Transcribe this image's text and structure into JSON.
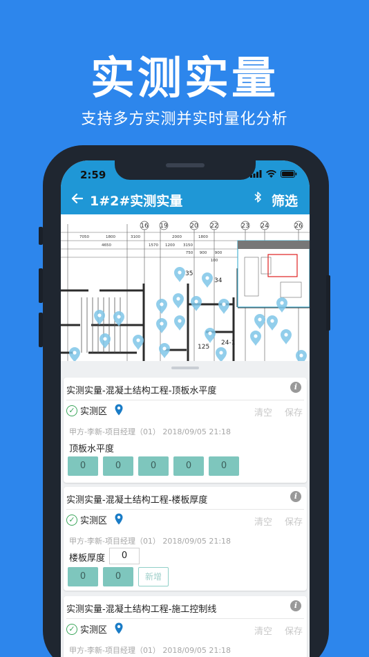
{
  "hero": {
    "title": "实测实量",
    "subtitle": "支持多方实测并实时量化分析"
  },
  "status_bar": {
    "time": "2:59"
  },
  "app_bar": {
    "back_icon": "arrow-left-icon",
    "title": "1#2#实测实量",
    "bluetooth_icon": "bluetooth-icon",
    "filter_label": "筛选"
  },
  "plan": {
    "axis_labels": [
      "16",
      "19",
      "20",
      "22",
      "23",
      "24",
      "26"
    ],
    "dimension_labels": [
      "7050",
      "1800",
      "3100",
      "4650",
      "1570",
      "2000",
      "1200",
      "3150",
      "1800",
      "750",
      "900",
      "900",
      "100"
    ],
    "markers": [
      "35",
      "34",
      "24-1",
      "125"
    ]
  },
  "cards": [
    {
      "title": "实测实量-混凝土结构工程-顶板水平度",
      "zone": "实测区",
      "clear_label": "清空",
      "save_label": "保存",
      "meta": "甲方-李新-项目经理（01） 2018/09/05 21:18",
      "field": "顶板水平度",
      "values": [
        "0",
        "0",
        "0",
        "0",
        "0"
      ]
    },
    {
      "title": "实测实量-混凝土结构工程-楼板厚度",
      "zone": "实测区",
      "clear_label": "清空",
      "save_label": "保存",
      "meta": "甲方-李新-项目经理（01） 2018/09/05 21:18",
      "field": "楼板厚度",
      "input_value": "0",
      "values": [
        "0",
        "0"
      ],
      "add_label": "新增"
    },
    {
      "title": "实测实量-混凝土结构工程-施工控制线",
      "zone": "实测区",
      "clear_label": "清空",
      "save_label": "保存",
      "meta": "甲方-李新-项目经理（01） 2018/09/05 21:18"
    }
  ],
  "colors": {
    "background": "#2d86ec",
    "app_bar": "#1f97d6",
    "value_box": "#7ec6bd",
    "marker": "#7fc6e8"
  }
}
